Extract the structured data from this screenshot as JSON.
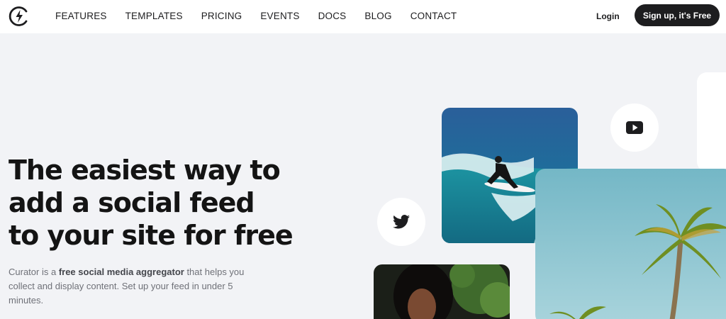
{
  "nav": {
    "links": [
      "FEATURES",
      "TEMPLATES",
      "PRICING",
      "EVENTS",
      "DOCS",
      "BLOG",
      "CONTACT"
    ],
    "login": "Login",
    "signup": "Sign up, it's Free"
  },
  "hero": {
    "headline": [
      "The easiest way to",
      "add a social feed",
      "to your site for free"
    ],
    "sub_prefix": "Curator is a ",
    "sub_bold": "free social media aggregator",
    "sub_suffix": " that helps you collect and display content. Set up your feed in under 5 minutes."
  },
  "icons": {
    "logo": "curator-logo-icon",
    "youtube": "youtube-icon",
    "twitter": "twitter-icon"
  },
  "colors": {
    "background": "#f2f3f6",
    "nav_bg": "#ffffff",
    "text": "#141414",
    "button_bg": "#1d1d1f"
  }
}
